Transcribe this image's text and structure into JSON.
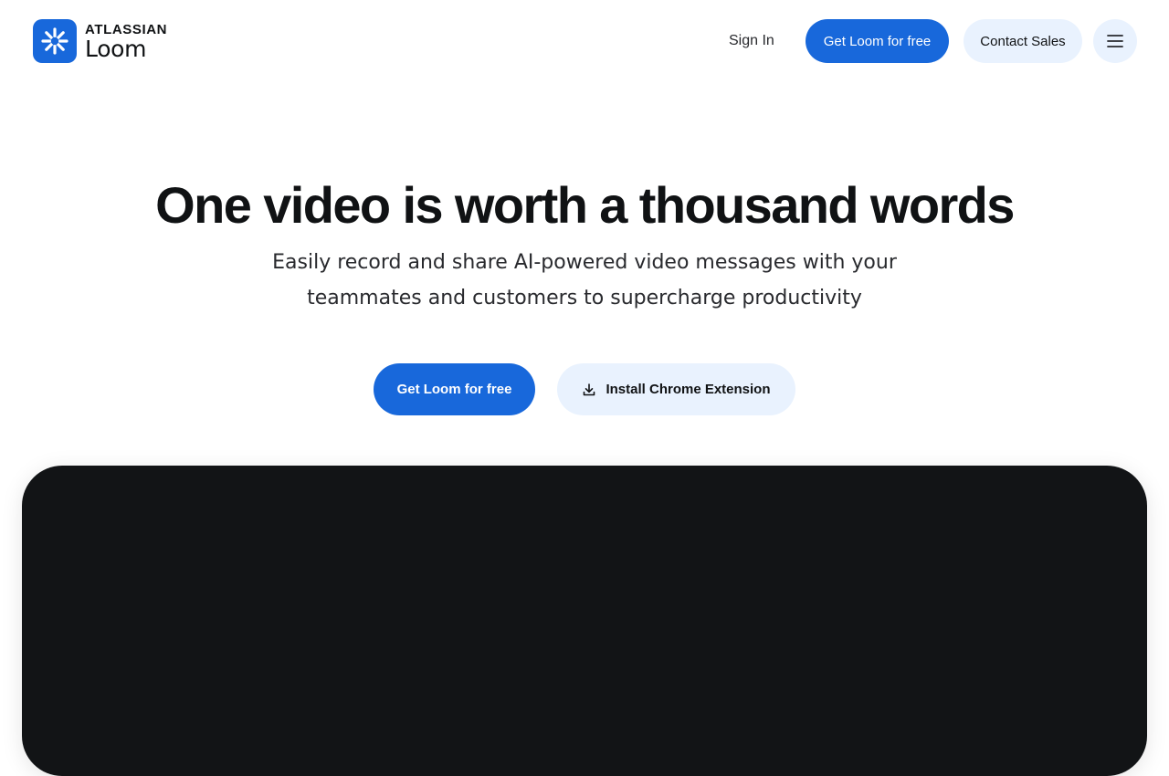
{
  "header": {
    "brand": {
      "top": "ATLASSIAN",
      "bottom": "Loom",
      "icon": "loom-logo-icon"
    },
    "signin_label": "Sign In",
    "cta_label": "Get Loom for free",
    "contact_label": "Contact Sales",
    "menu_icon": "hamburger-menu-icon"
  },
  "hero": {
    "title": "One video is worth a thousand words",
    "subtitle_line1": "Easily record and share AI-powered video messages with your",
    "subtitle_line2": "teammates and customers to supercharge productivity",
    "cta_label": "Get Loom for free",
    "extension_label": "Install Chrome Extension",
    "extension_icon": "download-icon"
  },
  "colors": {
    "brand_blue": "#1868db",
    "light_blue": "#e9f2fe",
    "text_dark": "#101214",
    "video_bg": "#121416"
  }
}
